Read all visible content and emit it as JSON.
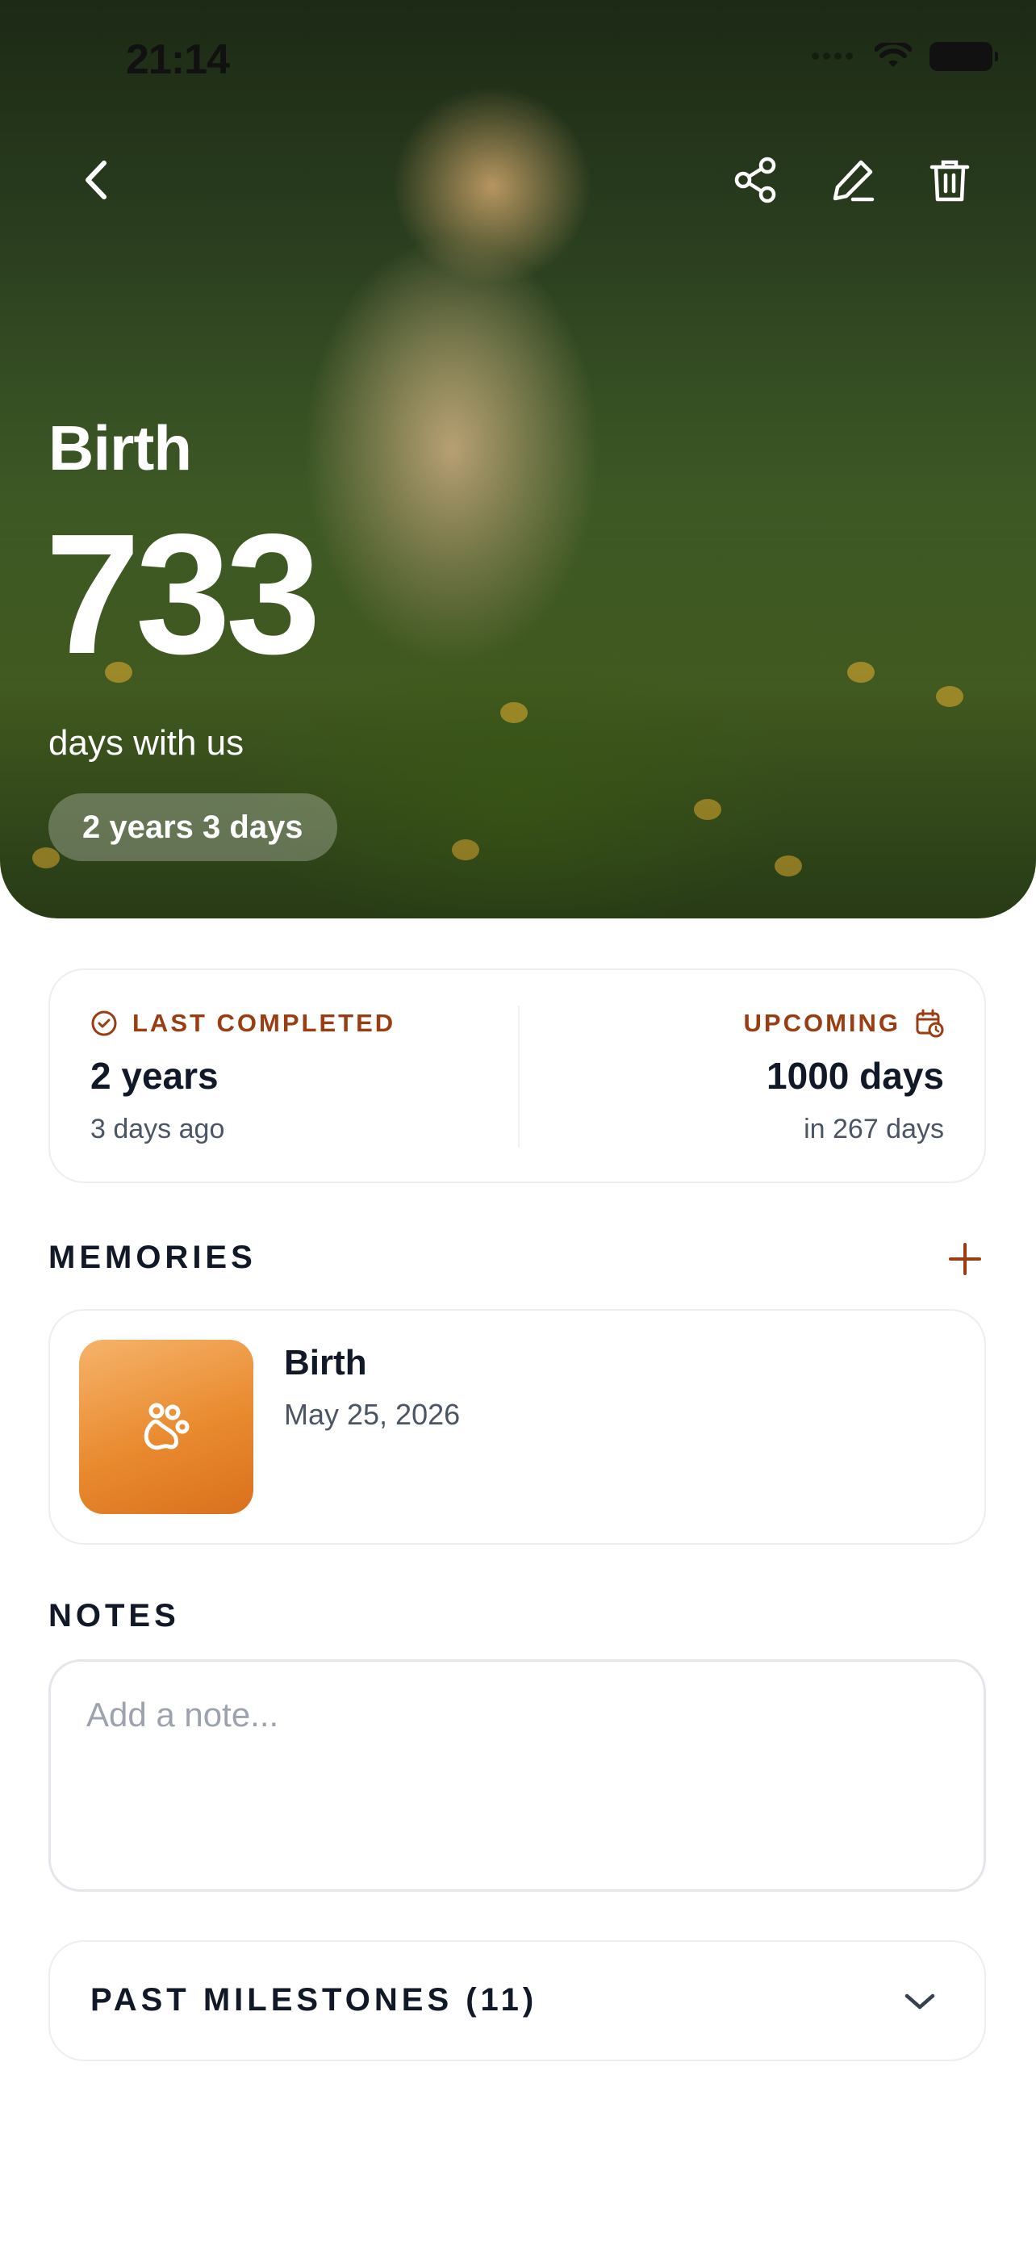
{
  "status_bar": {
    "time": "21:14"
  },
  "hero": {
    "title": "Birth",
    "count": "733",
    "subtitle": "days with us",
    "pill": "2 years 3 days"
  },
  "toolbar": {
    "back_icon": "chevron-left-icon",
    "share_icon": "share-icon",
    "edit_icon": "pencil-icon",
    "delete_icon": "trash-icon"
  },
  "stats": {
    "last_completed": {
      "label": "LAST COMPLETED",
      "value": "2 years",
      "sub": "3 days ago"
    },
    "upcoming": {
      "label": "UPCOMING",
      "value": "1000 days",
      "sub": "in 267 days"
    }
  },
  "memories": {
    "title": "MEMORIES",
    "items": [
      {
        "title": "Birth",
        "date": "May 25, 2026",
        "icon": "paw-icon"
      }
    ]
  },
  "notes": {
    "title": "NOTES",
    "placeholder": "Add a note..."
  },
  "past_milestones": {
    "label": "PAST MILESTONES (11)"
  },
  "colors": {
    "accent": "#9a3d12",
    "thumb_orange": "#e98a2f",
    "text": "#111827"
  }
}
